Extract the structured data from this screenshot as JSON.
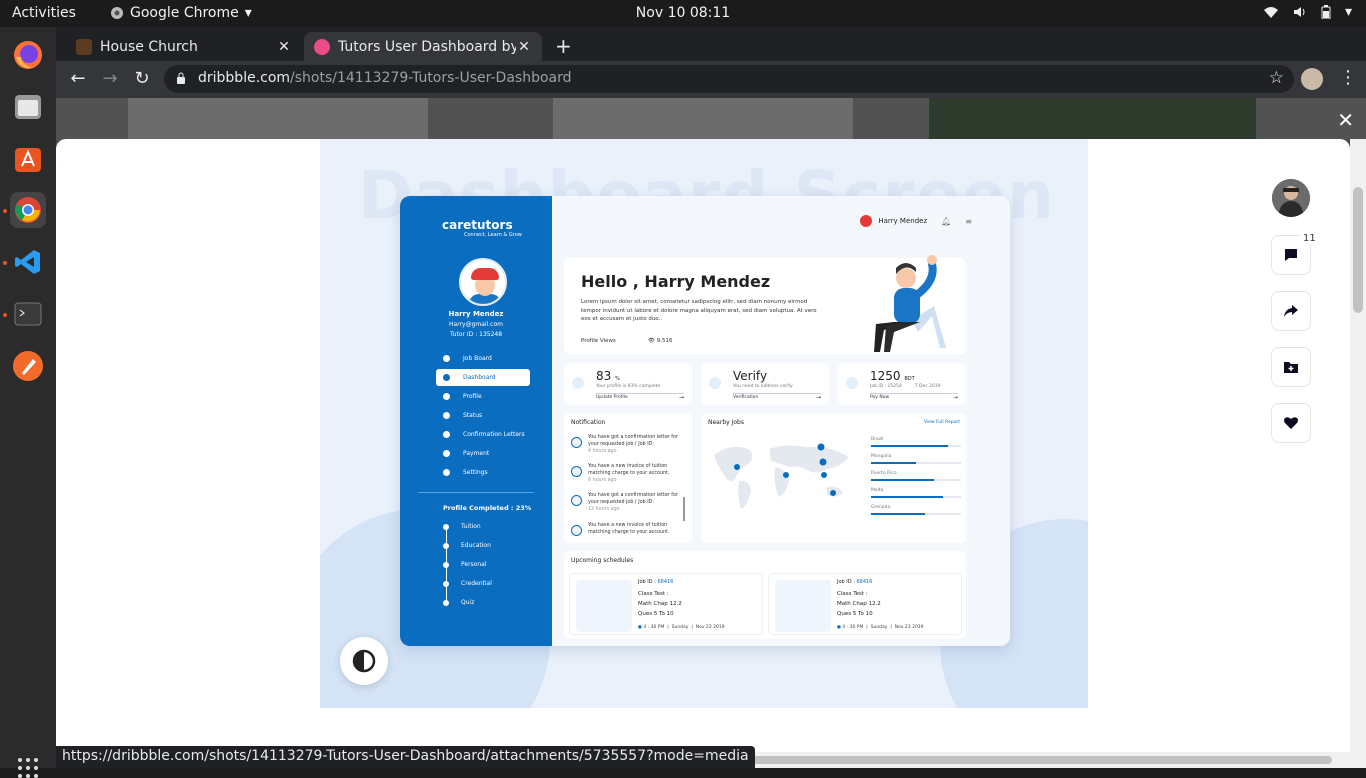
{
  "system": {
    "activities": "Activities",
    "app_name": "Google Chrome",
    "clock": "Nov 10  08:11"
  },
  "browser": {
    "tabs": [
      {
        "title": "House Church"
      },
      {
        "title": "Tutors User Dashboard by"
      }
    ],
    "url_domain": "dribbble.com",
    "url_path": "/shots/14113279-Tutors-User-Dashboard",
    "status_url": "https://dribbble.com/shots/14113279-Tutors-User-Dashboard/attachments/5735557?mode=media"
  },
  "shot": {
    "bg_text": "Dashboard Screen",
    "logo": "caretutors",
    "logo_tagline": "Connect, Learn & Grow",
    "user_name": "Harry Mendez",
    "user_email": "Harry@gmail.com",
    "tutor_id": "Tutor ID : 135248",
    "menu": [
      "Job Board",
      "Dashboard",
      "Profile",
      "Status",
      "Confirmation Letters",
      "Payment",
      "Settings"
    ],
    "profile_completed": "Profile Completed : 23%",
    "steps": [
      "Tuition",
      "Education",
      "Personal",
      "Credential",
      "Quiz"
    ],
    "header_name": "Harry Mendez",
    "hello_title": "Hello , Harry Mendez",
    "hello_text": "Lorem ipsum dolor sit amet, consetetur sadipscing elitr, sed diam nonumy eirmod tempor invidunt ut labore et dolore magna aliquyam erat, sed diam voluptua. At vero eos et accusam et justo duo..",
    "profile_views_label": "Profile Views",
    "profile_views": "9,516",
    "stats": [
      {
        "value": "83",
        "unit": "%",
        "sub": "Your profile is 83% complete",
        "link": "Update Profile"
      },
      {
        "value": "Verify",
        "unit": "",
        "sub": "You need to address verify",
        "link": "Verification"
      },
      {
        "value": "1250",
        "unit": "BDT",
        "sub": "Job ID : 15254         7 Dec 2019",
        "link": "Pay Now"
      }
    ],
    "notification_title": "Notification",
    "notifications": [
      {
        "text": "You have got a confirmation letter for your requested job ( Job ID:",
        "time": "4 hours ago"
      },
      {
        "text": "You have a new invoice of tuition matching charge to your account.",
        "time": "6 hours ago"
      },
      {
        "text": "You have got a confirmation letter for your requested job ( Job ID:",
        "time": "12  hours ago"
      },
      {
        "text": "You have a new invoice of tuition matching charge to your account.",
        "time": ""
      }
    ],
    "nearby_title": "Nearby Jobs",
    "view_full_report": "View Full Report",
    "countries": [
      {
        "name": "Brazil",
        "level": 0.85
      },
      {
        "name": "Mongolia",
        "level": 0.5
      },
      {
        "name": "Puerto Rico",
        "level": 0.7
      },
      {
        "name": "Malta",
        "level": 0.8
      },
      {
        "name": "Grenada",
        "level": 0.6
      }
    ],
    "schedule_title": "Upcoming schedules",
    "jobs": [
      {
        "id_label": "Job ID :",
        "id": "68416",
        "line1": "Class Test :",
        "line2": "Math Chap 12.2",
        "line3": "Ques 5 To 10",
        "time": "4 : 30 PM",
        "day": "Sunday",
        "date": "Nov 23 2019"
      },
      {
        "id_label": "Job ID :",
        "id": "68416",
        "line1": "Class Test :",
        "line2": "Math Chap 12.2",
        "line3": "Ques 5 To 10",
        "time": "4 : 30 PM",
        "day": "Sunday",
        "date": "Nov 23 2019"
      }
    ]
  },
  "rail": {
    "comment_count": "11"
  },
  "colors": {
    "brand": "#0a6dc0",
    "chrome_dark": "#202124",
    "dock": "#2b2b2b"
  }
}
